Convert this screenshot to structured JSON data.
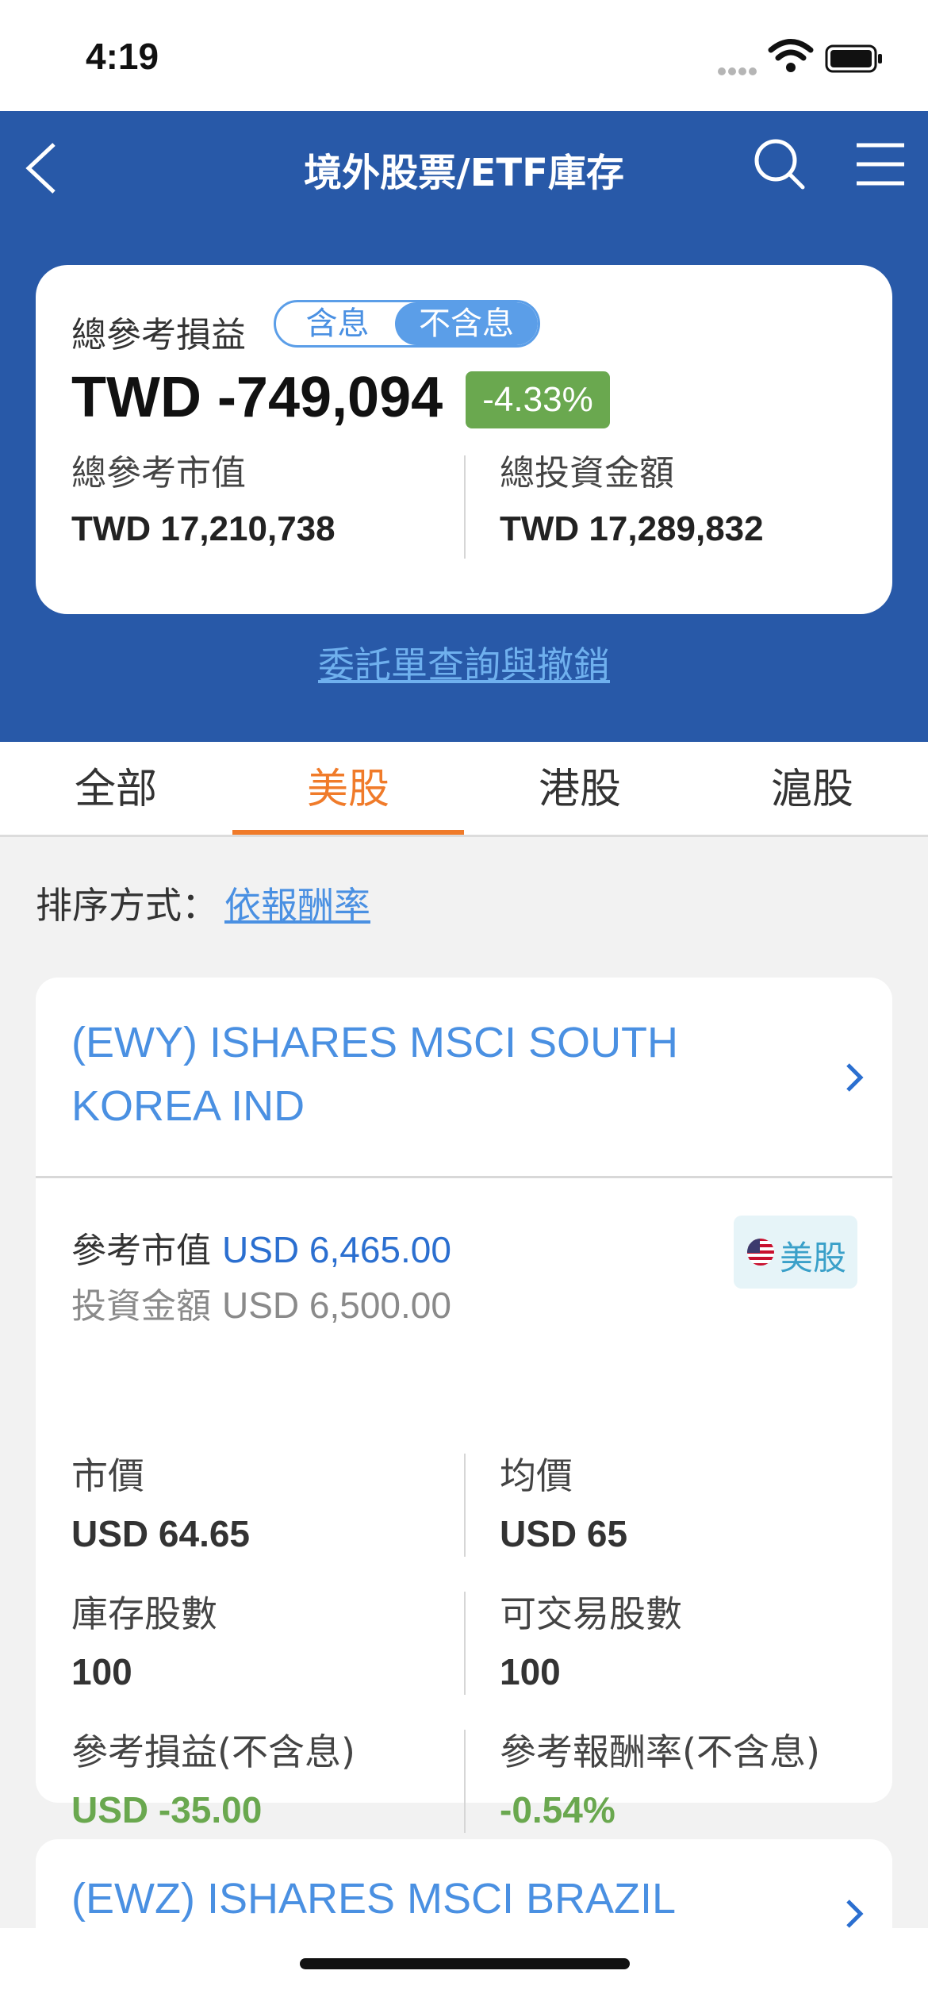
{
  "status_bar": {
    "time": "4:19"
  },
  "header": {
    "title": "境外股票/ETF庫存",
    "summary": {
      "label": "總參考損益",
      "toggle_off": "含息",
      "toggle_on": "不含息",
      "total_pnl": "TWD -749,094",
      "pnl_percent": "-4.33%",
      "market_value_label": "總參考市值",
      "market_value": "TWD 17,210,738",
      "investment_label": "總投資金額",
      "investment": "TWD 17,289,832"
    },
    "order_link": "委託單查詢與撤銷"
  },
  "tabs": [
    {
      "label": "全部",
      "active": false
    },
    {
      "label": "美股",
      "active": true
    },
    {
      "label": "港股",
      "active": false
    },
    {
      "label": "滬股",
      "active": false
    }
  ],
  "sort": {
    "label": "排序方式：",
    "value": "依報酬率"
  },
  "holdings": [
    {
      "title": "(EWY) ISHARES MSCI SOUTH KOREA IND",
      "market_value_label": "參考市值",
      "market_value": "USD 6,465.00",
      "investment_label": "投資金額",
      "investment": "USD 6,500.00",
      "market_badge": "美股",
      "price_label": "市價",
      "price": "USD 64.65",
      "avg_label": "均價",
      "avg": "USD 65",
      "shares_label": "庫存股數",
      "shares": "100",
      "tradable_label": "可交易股數",
      "tradable": "100",
      "pnl_label": "參考損益(不含息)",
      "pnl": "USD -35.00",
      "return_label": "參考報酬率(不含息)",
      "return": "-0.54%"
    },
    {
      "title": "(EWZ) ISHARES MSCI BRAZIL"
    }
  ],
  "colors": {
    "header_blue": "#2859a8",
    "accent_orange": "#f07b2a",
    "link_blue": "#4a90e2",
    "loss_green": "#6aa84f"
  }
}
